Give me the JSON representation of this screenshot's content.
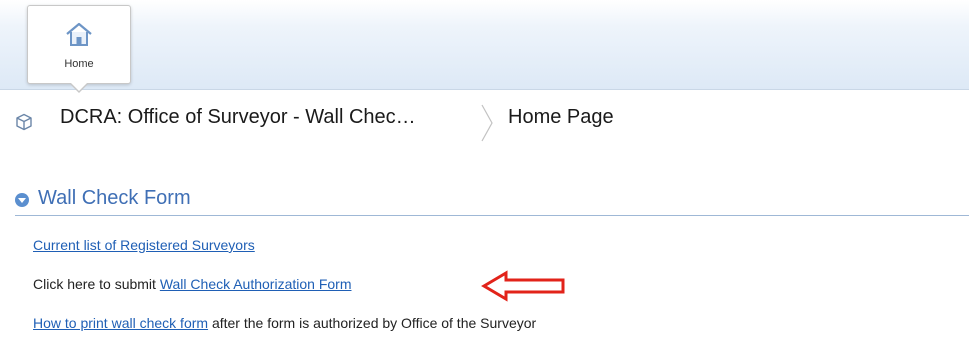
{
  "topbar": {
    "home_label": "Home"
  },
  "breadcrumb": {
    "app_title": "DCRA: Office of Surveyor - Wall Chec…",
    "page_title": "Home Page"
  },
  "section": {
    "title": "Wall Check Form"
  },
  "content": {
    "link_surveyors": "Current list of Registered Surveyors",
    "submit_prefix": "Click here to submit ",
    "link_authorization": "Wall Check Authorization Form",
    "link_print": "How to print wall check form",
    "print_suffix": " after the form is authorized by Office of the Surveyor"
  },
  "colors": {
    "link": "#1f5fb5",
    "section_title": "#3f6fb5",
    "annotation_arrow": "#e2231a"
  },
  "icons": [
    "home-icon",
    "cube-icon",
    "breadcrumb-separator-icon",
    "collapse-toggle-icon",
    "red-arrow-annotation"
  ]
}
